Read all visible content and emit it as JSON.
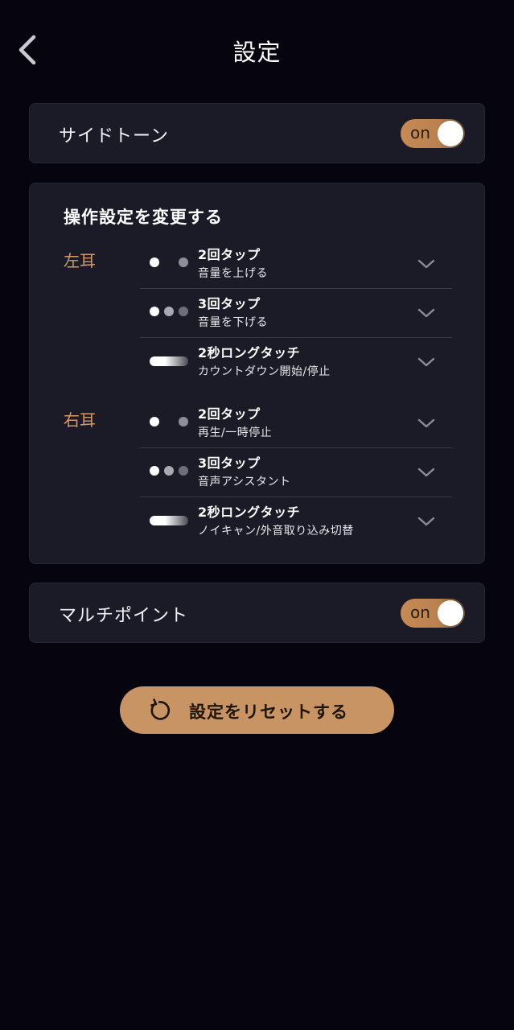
{
  "header": {
    "title": "設定",
    "back_icon": "chevron-left-icon"
  },
  "sidetone": {
    "label": "サイドトーン",
    "toggle_text": "on",
    "enabled": true
  },
  "operations": {
    "title": "操作設定を変更する",
    "left_ear": {
      "label": "左耳",
      "items": [
        {
          "gesture": "double-tap",
          "title": "2回タップ",
          "action": "音量を上げる"
        },
        {
          "gesture": "triple-tap",
          "title": "3回タップ",
          "action": "音量を下げる"
        },
        {
          "gesture": "long-touch",
          "title": "2秒ロングタッチ",
          "action": "カウントダウン開始/停止"
        }
      ]
    },
    "right_ear": {
      "label": "右耳",
      "items": [
        {
          "gesture": "double-tap",
          "title": "2回タップ",
          "action": "再生/一時停止"
        },
        {
          "gesture": "triple-tap",
          "title": "3回タップ",
          "action": "音声アシスタント"
        },
        {
          "gesture": "long-touch",
          "title": "2秒ロングタッチ",
          "action": "ノイキャン/外音取り込み切替"
        }
      ]
    }
  },
  "multipoint": {
    "label": "マルチポイント",
    "toggle_text": "on",
    "enabled": true
  },
  "reset": {
    "label": "設定をリセットする",
    "icon": "reset-icon"
  },
  "colors": {
    "background": "#05040f",
    "card": "#1b1b28",
    "accent": "#c99464",
    "ear_label": "#d19a6a"
  }
}
